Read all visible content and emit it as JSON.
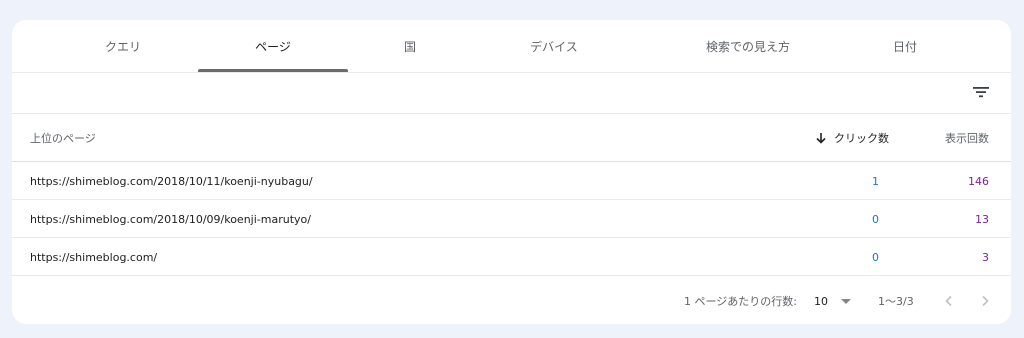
{
  "tabs": [
    {
      "label": "クエリ"
    },
    {
      "label": "ページ"
    },
    {
      "label": "国"
    },
    {
      "label": "デバイス"
    },
    {
      "label": "検索での見え方"
    },
    {
      "label": "日付"
    }
  ],
  "table": {
    "headers": {
      "page": "上位のページ",
      "clicks": "クリック数",
      "impressions": "表示回数"
    },
    "rows": [
      {
        "url": "https://shimeblog.com/2018/10/11/koenji-nyubagu/",
        "clicks": "1",
        "impressions": "146"
      },
      {
        "url": "https://shimeblog.com/2018/10/09/koenji-marutyo/",
        "clicks": "0",
        "impressions": "13"
      },
      {
        "url": "https://shimeblog.com/",
        "clicks": "0",
        "impressions": "3"
      }
    ]
  },
  "pagination": {
    "rows_per_page_label": "1 ページあたりの行数:",
    "rows_per_page_value": "10",
    "range": "1〜3/3"
  },
  "colors": {
    "clicks": "#1a73e8",
    "impressions": "#7b1fa2",
    "background": "#eef2fb"
  },
  "icons": {
    "filter": "filter-icon",
    "sort": "arrow-down-icon",
    "dropdown": "triangle-down-icon",
    "prev": "chevron-left-icon",
    "next": "chevron-right-icon"
  }
}
